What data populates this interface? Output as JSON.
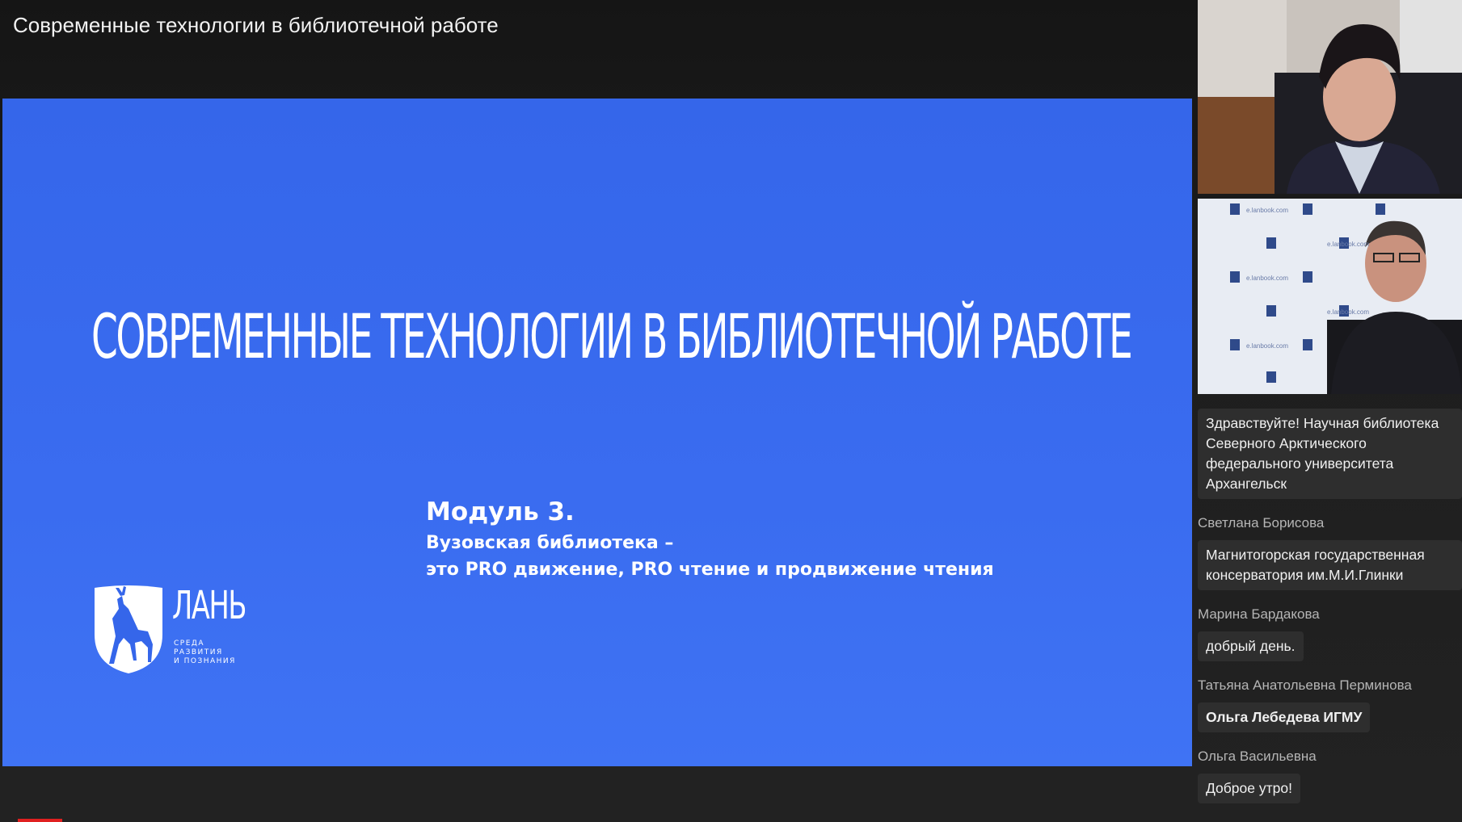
{
  "window": {
    "title": "Современные технологии в библиотечной работе"
  },
  "slide": {
    "title": "Современные технологии в библиотечной работе",
    "module_heading": "Модуль 3.",
    "module_line1": "Вузовская библиотека –",
    "module_line2": "это PRO движение, PRO чтение и продвижение чтения",
    "logo": {
      "name": "ЛАНЬ",
      "tagline": [
        "СРЕДА",
        "РАЗВИТИЯ",
        "И ПОЗНАНИЯ"
      ]
    },
    "background_color": "#3566ea"
  },
  "video_tiles": [
    {
      "semantic": "participant-video-woman"
    },
    {
      "semantic": "participant-video-man",
      "backdrop_text": "e.lanbook.com"
    }
  ],
  "chat": {
    "messages": [
      {
        "author": "",
        "text_lines": [
          "Здравствуйте! Научная библиотека",
          "Северного Арктического",
          "федерального университета",
          "Архангельск"
        ],
        "bold": false
      },
      {
        "author": "Светлана Борисова",
        "text_lines": [
          "Магнитогорская государственная",
          "консерватория  им.М.И.Глинки"
        ],
        "bold": false
      },
      {
        "author": "Марина Бардакова",
        "text_lines": [
          "добрый день."
        ],
        "bold": false
      },
      {
        "author": "Татьяна Анатольевна Перминова",
        "text_lines": [
          "Ольга Лебедева ИГМУ"
        ],
        "bold": true
      },
      {
        "author": "Ольга Васильевна",
        "text_lines": [
          "Доброе утро!"
        ],
        "bold": false
      }
    ]
  }
}
